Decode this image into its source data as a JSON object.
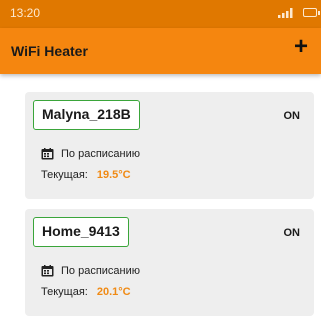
{
  "status_bar": {
    "time": "13:20"
  },
  "app_bar": {
    "title": "WiFi Heater",
    "add_label": "+"
  },
  "devices": [
    {
      "name": "Malyna_218B",
      "state": "ON",
      "mode": "По расписанию",
      "current_label": "Текущая:",
      "current_temp": "19.5°C"
    },
    {
      "name": "Home_9413",
      "state": "ON",
      "mode": "По расписанию",
      "current_label": "Текущая:",
      "current_temp": "20.1°C"
    }
  ],
  "colors": {
    "status_bar": "#e07800",
    "app_bar": "#f5860f",
    "card_bg": "#eeeeee",
    "name_border": "#3aa53a",
    "temp": "#f08a14"
  }
}
